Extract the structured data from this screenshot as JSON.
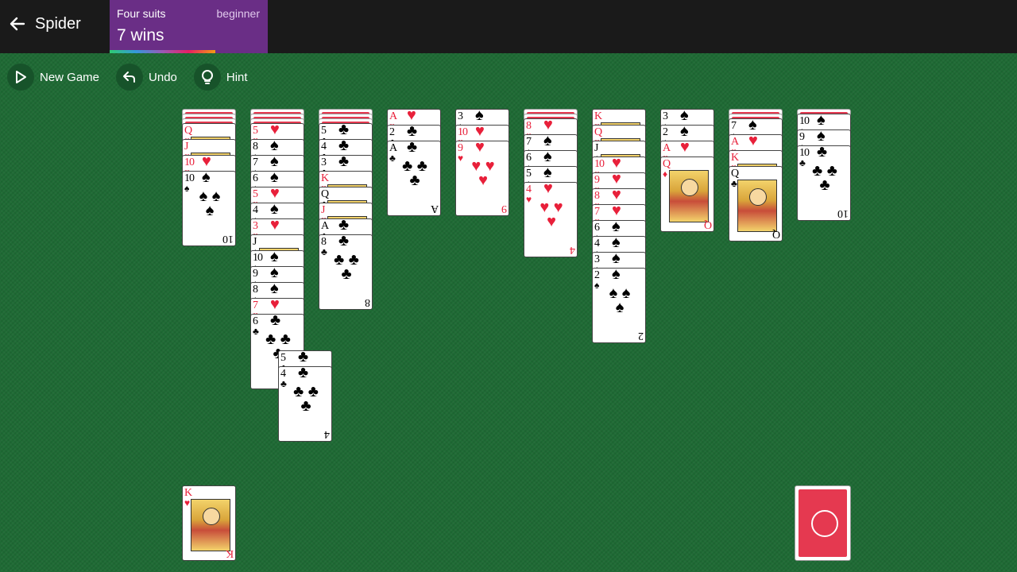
{
  "header": {
    "back_label": "Spider",
    "mode_suits": "Four suits",
    "mode_level": "beginner",
    "wins": "7 wins",
    "colors": {
      "bar": "#1a1a1a",
      "mode_card": "#6a2e86",
      "felt": "#1e6a34"
    }
  },
  "toolbar": {
    "new_game": "New Game",
    "undo": "Undo",
    "hint": "Hint"
  },
  "tableau": [
    {
      "facedown": 3,
      "cards": [
        {
          "rank": "Q",
          "suit": "♥",
          "face": true
        },
        {
          "rank": "J",
          "suit": "♥",
          "face": true
        },
        {
          "rank": "10",
          "suit": "♥"
        },
        {
          "rank": "10",
          "suit": "♠"
        }
      ]
    },
    {
      "facedown": 3,
      "cards": [
        {
          "rank": "5",
          "suit": "♥"
        },
        {
          "rank": "8",
          "suit": "♠"
        },
        {
          "rank": "7",
          "suit": "♠"
        },
        {
          "rank": "6",
          "suit": "♠"
        },
        {
          "rank": "5",
          "suit": "♥"
        },
        {
          "rank": "4",
          "suit": "♠"
        },
        {
          "rank": "3",
          "suit": "♥"
        },
        {
          "rank": "J",
          "suit": "♠",
          "face": true
        },
        {
          "rank": "10",
          "suit": "♠"
        },
        {
          "rank": "9",
          "suit": "♠"
        },
        {
          "rank": "8",
          "suit": "♠"
        },
        {
          "rank": "7",
          "suit": "♥"
        },
        {
          "rank": "6",
          "suit": "♣"
        }
      ]
    },
    {
      "facedown": 3,
      "cards": [
        {
          "rank": "5",
          "suit": "♣"
        },
        {
          "rank": "4",
          "suit": "♣"
        },
        {
          "rank": "3",
          "suit": "♣"
        },
        {
          "rank": "K",
          "suit": "♥",
          "face": true
        },
        {
          "rank": "Q",
          "suit": "♣",
          "face": true
        },
        {
          "rank": "J",
          "suit": "♥",
          "face": true
        },
        {
          "rank": "A",
          "suit": "♣"
        },
        {
          "rank": "8",
          "suit": "♣"
        }
      ]
    },
    {
      "facedown": 0,
      "cards": [
        {
          "rank": "A",
          "suit": "♥"
        },
        {
          "rank": "2",
          "suit": "♣"
        },
        {
          "rank": "A",
          "suit": "♣"
        }
      ]
    },
    {
      "facedown": 0,
      "cards": [
        {
          "rank": "3",
          "suit": "♠"
        },
        {
          "rank": "10",
          "suit": "♥"
        },
        {
          "rank": "9",
          "suit": "♥"
        }
      ]
    },
    {
      "facedown": 2,
      "cards": [
        {
          "rank": "8",
          "suit": "♥"
        },
        {
          "rank": "7",
          "suit": "♠"
        },
        {
          "rank": "6",
          "suit": "♠"
        },
        {
          "rank": "5",
          "suit": "♠"
        },
        {
          "rank": "4",
          "suit": "♥"
        }
      ]
    },
    {
      "facedown": 0,
      "cards": [
        {
          "rank": "K",
          "suit": "♥",
          "face": true
        },
        {
          "rank": "Q",
          "suit": "♥",
          "face": true
        },
        {
          "rank": "J",
          "suit": "♠",
          "face": true
        },
        {
          "rank": "10",
          "suit": "♥"
        },
        {
          "rank": "9",
          "suit": "♥"
        },
        {
          "rank": "8",
          "suit": "♥"
        },
        {
          "rank": "7",
          "suit": "♥"
        },
        {
          "rank": "6",
          "suit": "♠"
        },
        {
          "rank": "4",
          "suit": "♠"
        },
        {
          "rank": "3",
          "suit": "♠"
        },
        {
          "rank": "2",
          "suit": "♠"
        }
      ]
    },
    {
      "facedown": 0,
      "cards": [
        {
          "rank": "3",
          "suit": "♠"
        },
        {
          "rank": "2",
          "suit": "♠"
        },
        {
          "rank": "A",
          "suit": "♥"
        },
        {
          "rank": "Q",
          "suit": "♦",
          "face": true
        }
      ]
    },
    {
      "facedown": 2,
      "cards": [
        {
          "rank": "7",
          "suit": "♠"
        },
        {
          "rank": "A",
          "suit": "♥"
        },
        {
          "rank": "K",
          "suit": "♥",
          "face": true
        },
        {
          "rank": "Q",
          "suit": "♣",
          "face": true
        }
      ]
    },
    {
      "facedown": 1,
      "cards": [
        {
          "rank": "10",
          "suit": "♠"
        },
        {
          "rank": "9",
          "suit": "♠"
        },
        {
          "rank": "10",
          "suit": "♣"
        }
      ]
    }
  ],
  "dragging": [
    {
      "rank": "5",
      "suit": "♣"
    },
    {
      "rank": "4",
      "suit": "♣"
    }
  ],
  "foundation": {
    "rank": "K",
    "suit": "♥",
    "face": true
  },
  "stock_label": ""
}
